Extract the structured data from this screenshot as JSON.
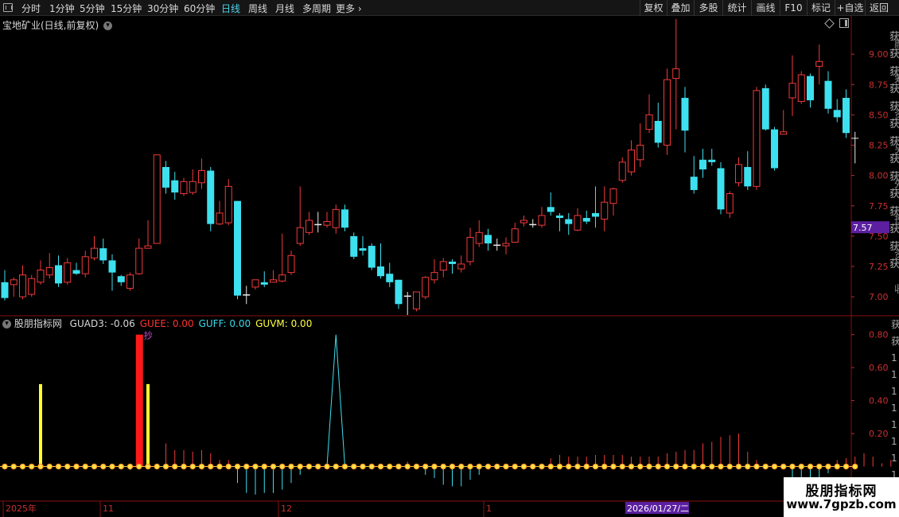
{
  "toolbar": {
    "periods": [
      {
        "label": "分时",
        "active": false
      },
      {
        "label": "1分钟",
        "active": false
      },
      {
        "label": "5分钟",
        "active": false
      },
      {
        "label": "15分钟",
        "active": false
      },
      {
        "label": "30分钟",
        "active": false
      },
      {
        "label": "60分钟",
        "active": false
      },
      {
        "label": "日线",
        "active": true
      },
      {
        "label": "周线",
        "active": false
      },
      {
        "label": "月线",
        "active": false
      },
      {
        "label": "多周期",
        "active": false
      },
      {
        "label": "更多",
        "active": false
      }
    ],
    "more_arrow": "›",
    "right_buttons": [
      "复权",
      "叠加",
      "多股",
      "统计",
      "画线",
      "F10",
      "标记",
      "+自选",
      "返回"
    ]
  },
  "main_chart": {
    "title": "宝地矿业(日线,前复权)",
    "title_icon": "chevron-down-icon",
    "price_axis": [
      "9.00",
      "8.75",
      "8.50",
      "8.25",
      "8.00",
      "7.75",
      "7.50",
      "7.25",
      "7.00"
    ],
    "current_price": "7.57",
    "ylim": [
      6.85,
      9.25
    ],
    "right_edge_text": [
      "获",
      "获",
      "获",
      "获",
      "获",
      "获",
      "获",
      "获",
      "获",
      "获",
      "获",
      "获",
      "获",
      "获"
    ],
    "right_edge_text2": [
      "融",
      "筹",
      "资",
      "另",
      "外",
      "投",
      "资",
      "收"
    ]
  },
  "indicator": {
    "name": "股朋指标网",
    "values": [
      {
        "label": "GUAD3: -0.06",
        "color": "#d8d8d8"
      },
      {
        "label": "GUEE: 0.00",
        "color": "#ff3030"
      },
      {
        "label": "GUFF: 0.00",
        "color": "#3ad8e8"
      },
      {
        "label": "GUVM: 0.00",
        "color": "#ffff40"
      }
    ],
    "axis_labels": [
      "0.80",
      "0.60",
      "0.40",
      "0.20"
    ],
    "marker_text": "抄",
    "right_edge_text": [
      "获",
      "获",
      "1",
      "1",
      "1",
      "1",
      "1",
      "1",
      "1",
      "1"
    ]
  },
  "date_axis": {
    "labels": [
      {
        "text": "2025年"
      },
      {
        "text": "11"
      },
      {
        "text": "12"
      },
      {
        "text": "1"
      }
    ],
    "highlight": "2026/01/27/二"
  },
  "watermark": {
    "name": "股朋指标网",
    "url": "www.7gpzb.com"
  },
  "chart_data": {
    "type": "candlestick",
    "title": "宝地矿业(日线,前复权)",
    "ylim": [
      6.85,
      9.25
    ],
    "candles": [
      {
        "o": 7.12,
        "c": 6.99,
        "h": 7.22,
        "l": 6.97
      },
      {
        "o": 7.1,
        "c": 7.14,
        "h": 7.16,
        "l": 7.0
      },
      {
        "o": 7.0,
        "c": 7.18,
        "h": 7.26,
        "l": 6.98
      },
      {
        "o": 7.02,
        "c": 7.15,
        "h": 7.18,
        "l": 7.0
      },
      {
        "o": 7.12,
        "c": 7.22,
        "h": 7.3,
        "l": 7.1
      },
      {
        "o": 7.18,
        "c": 7.24,
        "h": 7.36,
        "l": 7.15
      },
      {
        "o": 7.26,
        "c": 7.11,
        "h": 7.34,
        "l": 7.08
      },
      {
        "o": 7.12,
        "c": 7.28,
        "h": 7.32,
        "l": 7.1
      },
      {
        "o": 7.22,
        "c": 7.19,
        "h": 7.28,
        "l": 7.18
      },
      {
        "o": 7.19,
        "c": 7.33,
        "h": 7.38,
        "l": 7.16
      },
      {
        "o": 7.32,
        "c": 7.4,
        "h": 7.5,
        "l": 7.3
      },
      {
        "o": 7.4,
        "c": 7.3,
        "h": 7.48,
        "l": 7.27
      },
      {
        "o": 7.3,
        "c": 7.2,
        "h": 7.35,
        "l": 7.05
      },
      {
        "o": 7.17,
        "c": 7.12,
        "h": 7.18,
        "l": 7.09
      },
      {
        "o": 7.07,
        "c": 7.18,
        "h": 7.2,
        "l": 7.05
      },
      {
        "o": 7.19,
        "c": 7.4,
        "h": 7.48,
        "l": 7.18
      },
      {
        "o": 7.4,
        "c": 7.42,
        "h": 7.63,
        "l": 7.4
      },
      {
        "o": 7.44,
        "c": 8.17,
        "h": 8.17,
        "l": 7.44
      },
      {
        "o": 8.07,
        "c": 7.9,
        "h": 8.12,
        "l": 7.85
      },
      {
        "o": 7.96,
        "c": 7.86,
        "h": 8.03,
        "l": 7.8
      },
      {
        "o": 7.85,
        "c": 7.95,
        "h": 7.98,
        "l": 7.83
      },
      {
        "o": 7.86,
        "c": 7.95,
        "h": 8.05,
        "l": 7.84
      },
      {
        "o": 7.94,
        "c": 8.04,
        "h": 8.14,
        "l": 7.89
      },
      {
        "o": 8.04,
        "c": 7.6,
        "h": 8.07,
        "l": 7.54
      },
      {
        "o": 7.6,
        "c": 7.69,
        "h": 7.79,
        "l": 7.59
      },
      {
        "o": 7.61,
        "c": 7.91,
        "h": 7.97,
        "l": 7.59
      },
      {
        "o": 7.79,
        "c": 7.01,
        "h": 7.79,
        "l": 6.98
      },
      {
        "o": 7.02,
        "c": 7.01,
        "h": 7.09,
        "l": 6.94
      },
      {
        "o": 7.08,
        "c": 7.14,
        "h": 7.14,
        "l": 7.06
      },
      {
        "o": 7.12,
        "c": 7.1,
        "h": 7.21,
        "l": 7.08
      },
      {
        "o": 7.12,
        "c": 7.14,
        "h": 7.22,
        "l": 7.12
      },
      {
        "o": 7.13,
        "c": 7.18,
        "h": 7.52,
        "l": 7.12
      },
      {
        "o": 7.2,
        "c": 7.34,
        "h": 7.38,
        "l": 7.18
      },
      {
        "o": 7.44,
        "c": 7.57,
        "h": 7.91,
        "l": 7.42
      },
      {
        "o": 7.53,
        "c": 7.63,
        "h": 7.7,
        "l": 7.51
      },
      {
        "o": 7.6,
        "c": 7.59,
        "h": 7.7,
        "l": 7.53
      },
      {
        "o": 7.59,
        "c": 7.62,
        "h": 7.7,
        "l": 7.57
      },
      {
        "o": 7.57,
        "c": 7.72,
        "h": 7.76,
        "l": 7.52
      },
      {
        "o": 7.72,
        "c": 7.57,
        "h": 7.76,
        "l": 7.54
      },
      {
        "o": 7.5,
        "c": 7.33,
        "h": 7.53,
        "l": 7.31
      },
      {
        "o": 7.4,
        "c": 7.38,
        "h": 7.5,
        "l": 7.34
      },
      {
        "o": 7.42,
        "c": 7.24,
        "h": 7.44,
        "l": 7.22
      },
      {
        "o": 7.25,
        "c": 7.17,
        "h": 7.44,
        "l": 7.15
      },
      {
        "o": 7.19,
        "c": 7.12,
        "h": 7.28,
        "l": 7.08
      },
      {
        "o": 7.14,
        "c": 6.94,
        "h": 7.14,
        "l": 6.9
      },
      {
        "o": 7.0,
        "c": 7.01,
        "h": 7.04,
        "l": 6.85
      },
      {
        "o": 6.9,
        "c": 7.04,
        "h": 7.04,
        "l": 6.88
      },
      {
        "o": 7.0,
        "c": 7.16,
        "h": 7.17,
        "l": 6.98
      },
      {
        "o": 7.14,
        "c": 7.2,
        "h": 7.31,
        "l": 7.11
      },
      {
        "o": 7.22,
        "c": 7.29,
        "h": 7.32,
        "l": 7.16
      },
      {
        "o": 7.29,
        "c": 7.27,
        "h": 7.31,
        "l": 7.19
      },
      {
        "o": 7.23,
        "c": 7.27,
        "h": 7.34,
        "l": 7.2
      },
      {
        "o": 7.29,
        "c": 7.49,
        "h": 7.57,
        "l": 7.26
      },
      {
        "o": 7.44,
        "c": 7.53,
        "h": 7.63,
        "l": 7.41
      },
      {
        "o": 7.51,
        "c": 7.44,
        "h": 7.56,
        "l": 7.38
      },
      {
        "o": 7.43,
        "c": 7.42,
        "h": 7.48,
        "l": 7.38
      },
      {
        "o": 7.42,
        "c": 7.44,
        "h": 7.49,
        "l": 7.35
      },
      {
        "o": 7.45,
        "c": 7.56,
        "h": 7.61,
        "l": 7.45
      },
      {
        "o": 7.61,
        "c": 7.63,
        "h": 7.67,
        "l": 7.58
      },
      {
        "o": 7.6,
        "c": 7.59,
        "h": 7.64,
        "l": 7.57
      },
      {
        "o": 7.59,
        "c": 7.67,
        "h": 7.74,
        "l": 7.57
      },
      {
        "o": 7.74,
        "c": 7.7,
        "h": 7.86,
        "l": 7.67
      },
      {
        "o": 7.67,
        "c": 7.65,
        "h": 7.69,
        "l": 7.54
      },
      {
        "o": 7.64,
        "c": 7.6,
        "h": 7.69,
        "l": 7.51
      },
      {
        "o": 7.55,
        "c": 7.67,
        "h": 7.73,
        "l": 7.54
      },
      {
        "o": 7.65,
        "c": 7.62,
        "h": 7.71,
        "l": 7.6
      },
      {
        "o": 7.69,
        "c": 7.66,
        "h": 7.91,
        "l": 7.57
      },
      {
        "o": 7.64,
        "c": 7.78,
        "h": 7.91,
        "l": 7.54
      },
      {
        "o": 7.77,
        "c": 7.89,
        "h": 7.9,
        "l": 7.67
      },
      {
        "o": 7.96,
        "c": 8.11,
        "h": 8.15,
        "l": 7.94
      },
      {
        "o": 8.03,
        "c": 8.21,
        "h": 8.29,
        "l": 8.0
      },
      {
        "o": 8.13,
        "c": 8.25,
        "h": 8.43,
        "l": 8.07
      },
      {
        "o": 8.38,
        "c": 8.5,
        "h": 8.67,
        "l": 8.35
      },
      {
        "o": 8.45,
        "c": 8.27,
        "h": 8.6,
        "l": 8.23
      },
      {
        "o": 8.25,
        "c": 8.79,
        "h": 8.88,
        "l": 8.17
      },
      {
        "o": 8.8,
        "c": 8.88,
        "h": 9.29,
        "l": 8.38
      },
      {
        "o": 8.64,
        "c": 8.37,
        "h": 8.73,
        "l": 8.19
      },
      {
        "o": 7.99,
        "c": 7.88,
        "h": 8.16,
        "l": 7.85
      },
      {
        "o": 8.13,
        "c": 8.05,
        "h": 8.22,
        "l": 7.98
      },
      {
        "o": 8.13,
        "c": 8.11,
        "h": 8.22,
        "l": 8.08
      },
      {
        "o": 8.06,
        "c": 7.72,
        "h": 8.11,
        "l": 7.68
      },
      {
        "o": 7.69,
        "c": 7.85,
        "h": 7.87,
        "l": 7.65
      },
      {
        "o": 7.94,
        "c": 8.09,
        "h": 8.15,
        "l": 7.91
      },
      {
        "o": 8.07,
        "c": 7.91,
        "h": 8.2,
        "l": 7.88
      },
      {
        "o": 7.91,
        "c": 8.7,
        "h": 8.73,
        "l": 7.88
      },
      {
        "o": 8.72,
        "c": 8.38,
        "h": 8.75,
        "l": 8.37
      },
      {
        "o": 8.38,
        "c": 8.06,
        "h": 8.4,
        "l": 8.04
      },
      {
        "o": 8.34,
        "c": 8.36,
        "h": 8.54,
        "l": 8.34
      },
      {
        "o": 8.64,
        "c": 8.76,
        "h": 8.99,
        "l": 8.49
      },
      {
        "o": 8.61,
        "c": 8.83,
        "h": 8.86,
        "l": 8.59
      },
      {
        "o": 8.82,
        "c": 8.62,
        "h": 8.84,
        "l": 8.56
      },
      {
        "o": 8.9,
        "c": 8.94,
        "h": 9.08,
        "l": 8.75
      },
      {
        "o": 8.78,
        "c": 8.55,
        "h": 8.86,
        "l": 8.51
      },
      {
        "o": 8.54,
        "c": 8.48,
        "h": 8.63,
        "l": 8.44
      },
      {
        "o": 8.64,
        "c": 8.35,
        "h": 8.71,
        "l": 8.31
      },
      {
        "o": 8.31,
        "c": 8.31,
        "h": 8.36,
        "l": 8.1
      }
    ],
    "indicator": {
      "ylim": [
        -0.2,
        0.9
      ],
      "guad3": [
        0,
        0.01,
        0,
        0,
        0,
        0,
        0,
        0,
        0,
        0,
        0,
        0,
        0,
        0,
        -0.02,
        0,
        0,
        0,
        0.14,
        0.1,
        0.1,
        0.09,
        0.1,
        0.08,
        0.04,
        0.04,
        -0.1,
        -0.16,
        -0.17,
        -0.16,
        -0.16,
        -0.14,
        -0.1,
        -0.05,
        0,
        0,
        0,
        0,
        0,
        0,
        0,
        0,
        0,
        0,
        0,
        0.03,
        0,
        -0.05,
        -0.07,
        -0.11,
        -0.12,
        -0.12,
        -0.08,
        -0.05,
        0,
        0,
        0,
        0,
        0,
        0,
        0.01,
        0.05,
        0.07,
        0.06,
        0.06,
        0.06,
        0.07,
        0.07,
        0.07,
        0.07,
        0.06,
        0.06,
        0.06,
        0.06,
        0.08,
        0.09,
        0.1,
        0.1,
        0.14,
        0.15,
        0.18,
        0.19,
        0.2,
        0.09,
        0.04,
        0,
        0,
        0,
        -0.08,
        -0.12,
        -0.12,
        -0.1,
        -0.04,
        0.04,
        0.05,
        0.06,
        0.08,
        0.06,
        0.02,
        0.04,
        -0.06
      ],
      "guee_index": 15,
      "guee_value": 0.8,
      "guvm_indices": [
        4,
        16
      ],
      "guvm_value": 0.5,
      "guff_peak_index": 37,
      "guff_peak_value": 0.8
    }
  }
}
